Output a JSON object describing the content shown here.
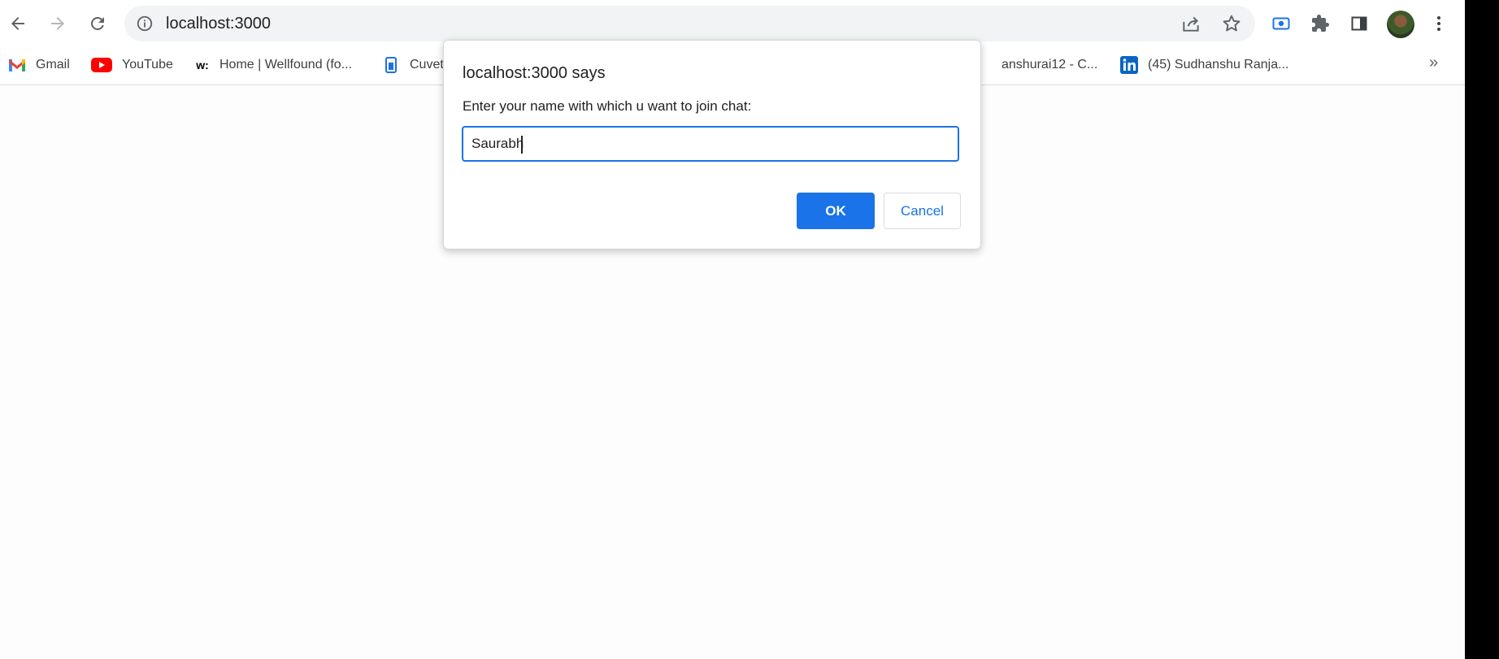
{
  "toolbar": {
    "url": "localhost:3000",
    "icons": [
      "back-arrow-icon",
      "forward-arrow-icon",
      "reload-icon",
      "info-icon",
      "share-icon",
      "star-icon",
      "screencast-icon",
      "extensions-icon",
      "side-panel-icon",
      "profile-avatar",
      "kebab-menu-icon"
    ]
  },
  "bookmarks": [
    {
      "label": "Gmail",
      "icon": "gmail-icon"
    },
    {
      "label": "YouTube",
      "icon": "youtube-icon"
    },
    {
      "label": "Home | Wellfound (fo...",
      "icon": "wellfound-icon"
    },
    {
      "label": "Cuvette",
      "icon": "cuvette-icon"
    },
    {
      "label": "anshurai12 - C...",
      "icon": "none"
    },
    {
      "label": "(45) Sudhanshu Ranja...",
      "icon": "linkedin-icon"
    }
  ],
  "bookmarks_overflow": "»",
  "dialog": {
    "title": "localhost:3000 says",
    "message": "Enter your name with which u want to join chat:",
    "input_value": "Saurabh",
    "ok_label": "OK",
    "cancel_label": "Cancel"
  },
  "colors": {
    "accent": "#1a73e8",
    "omnibox_bg": "#f1f3f4",
    "youtube_red": "#ff0000",
    "linkedin_blue": "#0a66c2"
  }
}
